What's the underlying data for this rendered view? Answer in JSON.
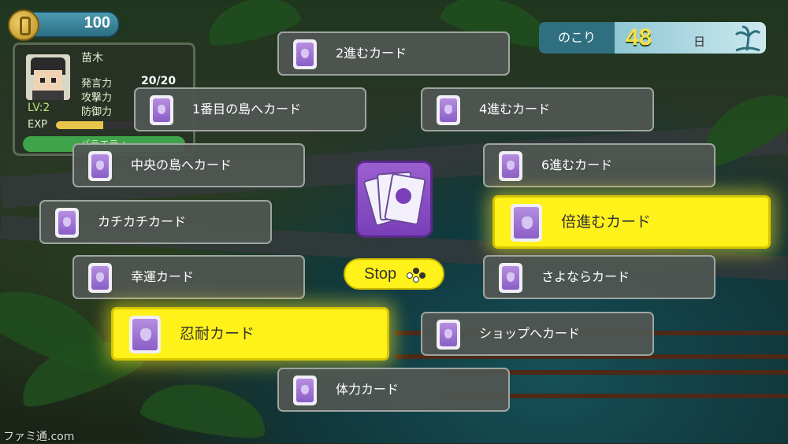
{
  "coins": {
    "value": "100",
    "icon": "coin-icon"
  },
  "player": {
    "name": "苗木",
    "stats": [
      "発言力",
      "攻撃力",
      "防御力"
    ],
    "speech_value": "20/20",
    "level": "LV:2",
    "exp_label": "EXP",
    "exp_fill": 0.4,
    "tag": "バラエティ"
  },
  "days": {
    "label": "のこり",
    "value": "48",
    "unit": "日"
  },
  "cards": [
    {
      "label": "2進むカード",
      "selected": false
    },
    {
      "label": "1番目の島へカード",
      "selected": false
    },
    {
      "label": "4進むカード",
      "selected": false
    },
    {
      "label": "中央の島へカード",
      "selected": false
    },
    {
      "label": "6進むカード",
      "selected": false
    },
    {
      "label": "カチカチカード",
      "selected": false
    },
    {
      "label": "倍進むカード",
      "selected": true
    },
    {
      "label": "幸運カード",
      "selected": false
    },
    {
      "label": "さよならカード",
      "selected": false
    },
    {
      "label": "忍耐カード",
      "selected": true
    },
    {
      "label": "ショップへカード",
      "selected": false
    },
    {
      "label": "体力カード",
      "selected": false
    }
  ],
  "stop_button": {
    "label": "Stop",
    "icon": "controller-button-icon"
  },
  "deck_icon": "card-deck-icon",
  "watermark": "ファミ通.com",
  "colors": {
    "highlight": "#fff11a",
    "card_purple": "#8a5ec7",
    "button_gray": "#50564f"
  }
}
